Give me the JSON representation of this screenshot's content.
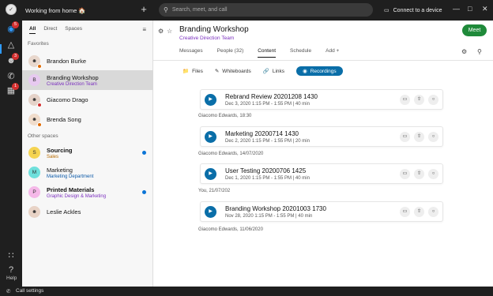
{
  "topbar": {
    "avatar_initial": "✓",
    "status": "Working from home 🏠",
    "new_label": "+",
    "search_placeholder": "Search, meet, and call",
    "connect_label": "Connect to a device"
  },
  "leftrail": {
    "badges": [
      "5",
      "3",
      "1"
    ],
    "help_label": "Help"
  },
  "sidebar": {
    "tabs": [
      "All",
      "Direct",
      "Spaces"
    ],
    "favorites_heading": "Favorites",
    "other_heading": "Other spaces",
    "favorites": [
      {
        "name": "Brandon Burke",
        "subtitle": "",
        "initial": "",
        "avatar_color": "#e8d7cc",
        "presence": "orange"
      },
      {
        "name": "Branding Workshop",
        "subtitle": "Creative Direction Team",
        "initial": "B",
        "avatar_color": "#e7c9f0",
        "selected": true
      },
      {
        "name": "Giacomo Drago",
        "subtitle": "",
        "initial": "",
        "avatar_color": "#e5d2c8",
        "presence": "red"
      },
      {
        "name": "Brenda Song",
        "subtitle": "",
        "initial": "",
        "avatar_color": "#f0dccb",
        "presence": "orange"
      }
    ],
    "others": [
      {
        "name": "Sourcing",
        "subtitle": "Sales",
        "initial": "S",
        "avatar_color": "#f5d452",
        "bold": true,
        "unread": true,
        "sub_color": "orange"
      },
      {
        "name": "Marketing",
        "subtitle": "Marketing Department",
        "initial": "M",
        "avatar_color": "#6fe0dc",
        "bold": false,
        "unread": false,
        "sub_color": "blue"
      },
      {
        "name": "Printed Materials",
        "subtitle": "Graphic Design & Marketing",
        "initial": "P",
        "avatar_color": "#f5b8e8",
        "bold": true,
        "unread": true,
        "sub_color": "purple"
      },
      {
        "name": "Leslie Ackles",
        "subtitle": "",
        "initial": "",
        "avatar_color": "#e8d3c6",
        "bold": false,
        "unread": false
      }
    ]
  },
  "main": {
    "title": "Branding Workshop",
    "subtitle": "Creative Direction Team",
    "meet_label": "Meet",
    "nav_tabs": [
      "Messages",
      "People (32)",
      "Content",
      "Schedule",
      "Add"
    ],
    "content_tabs": [
      "Files",
      "Whiteboards",
      "Links",
      "Recordings"
    ],
    "recordings": [
      {
        "title": "Rebrand Review 20201208 1430",
        "meta": "Dec 3, 2020 1:15 PM - 1:55 PM  |  40 min",
        "sender": "Giacomo Edwards, 18:30"
      },
      {
        "title": "Marketing 20200714 1430",
        "meta": "Dec 2, 2020 1:15 PM - 1:55 PM  |  20 min",
        "sender": "Giacomo Edwards, 14/07/2020"
      },
      {
        "title": "User Testing 20200706 1425",
        "meta": "Dec 1, 2020 1:15 PM - 1:55 PM  |  40 min",
        "sender": "You, 21/07/202"
      },
      {
        "title": "Branding Workshop 20201003 1730",
        "meta": "Nov 28, 2020 1:15 PM - 1:55 PM  |  40 min",
        "sender": "Giacomo Edwards, 11/06/2020"
      }
    ]
  },
  "bottombar": {
    "call_settings": "Call settings"
  }
}
